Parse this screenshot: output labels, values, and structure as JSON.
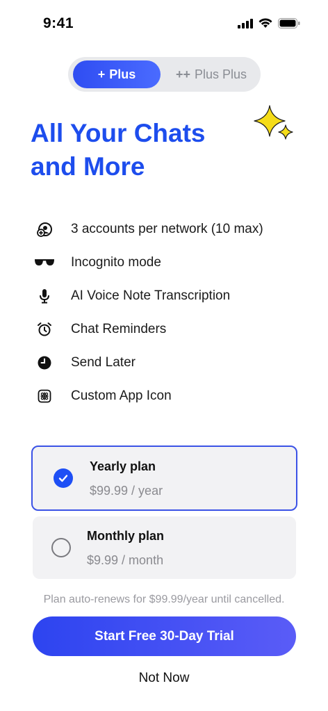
{
  "status_bar": {
    "time": "9:41",
    "icons": [
      "cellular-signal-icon",
      "wifi-icon",
      "battery-icon"
    ]
  },
  "plan_tabs": [
    {
      "prefix": "+",
      "label": "Plus",
      "selected": true
    },
    {
      "prefix": "++",
      "label": "Plus Plus",
      "selected": false
    }
  ],
  "headline": {
    "line1": "All Your Chats",
    "line2": "and More",
    "decoration_icon": "sparkles-icon"
  },
  "features": [
    {
      "icon": "accounts-add-icon",
      "label": "3 accounts per network (10 max)"
    },
    {
      "icon": "sunglasses-icon",
      "label": "Incognito mode"
    },
    {
      "icon": "microphone-icon",
      "label": "AI Voice Note Transcription"
    },
    {
      "icon": "alarm-clock-icon",
      "label": "Chat Reminders"
    },
    {
      "icon": "clock-icon",
      "label": "Send Later"
    },
    {
      "icon": "app-icon-grid-icon",
      "label": "Custom App Icon"
    }
  ],
  "plans": [
    {
      "title": "Yearly plan",
      "price": "$99.99 / year",
      "selected": true
    },
    {
      "title": "Monthly plan",
      "price": "$9.99 / month",
      "selected": false
    }
  ],
  "renew_note": "Plan auto-renews for $99.99/year until cancelled.",
  "cta_label": "Start Free 30-Day Trial",
  "secondary_label": "Not Now",
  "colors": {
    "accent": "#1d4ded",
    "cta_gradient_start": "#2d44f0",
    "cta_gradient_end": "#5a5cf7",
    "sparkle": "#f5dc19",
    "selected_border": "#3b52e6"
  }
}
